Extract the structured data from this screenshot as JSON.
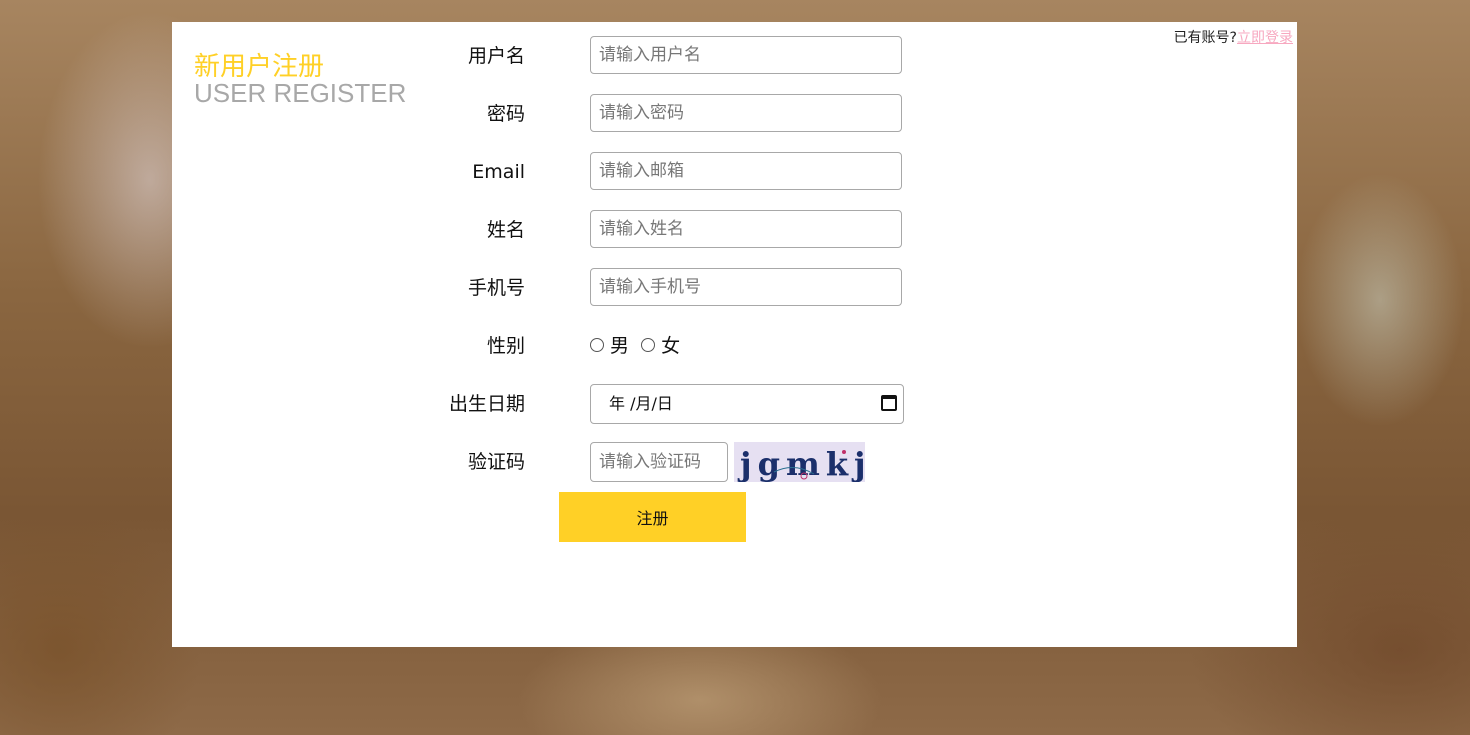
{
  "header": {
    "title_cn": "新用户注册",
    "title_en": "USER REGISTER",
    "login_prompt": "已有账号?",
    "login_link": "立即登录"
  },
  "form": {
    "username": {
      "label": "用户名",
      "placeholder": "请输入用户名"
    },
    "password": {
      "label": "密码",
      "placeholder": "请输入密码"
    },
    "email": {
      "label": "Email",
      "placeholder": "请输入邮箱"
    },
    "name": {
      "label": "姓名",
      "placeholder": "请输入姓名"
    },
    "phone": {
      "label": "手机号",
      "placeholder": "请输入手机号"
    },
    "gender": {
      "label": "性别",
      "male": "男",
      "female": "女"
    },
    "birthday": {
      "label": "出生日期",
      "value": "年 /月/日"
    },
    "captcha": {
      "label": "验证码",
      "placeholder": "请输入验证码",
      "image_text": "jgmkj"
    },
    "submit_label": "注册"
  },
  "colors": {
    "accent": "#ffd026",
    "link": "#f7a8c0",
    "subtitle": "#a8a8a8"
  }
}
